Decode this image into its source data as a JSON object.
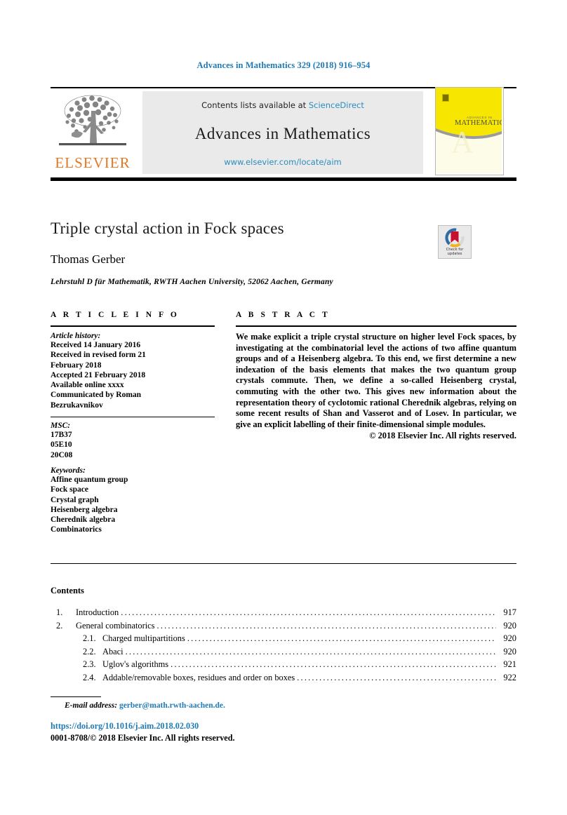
{
  "running_head": "Advances in Mathematics 329 (2018) 916–954",
  "masthead": {
    "contents_prefix": "Contents lists available at ",
    "sciencedirect": "ScienceDirect",
    "journal_name": "Advances in Mathematics",
    "journal_url": "www.elsevier.com/locate/aim",
    "publisher_wordmark": "ELSEVIER",
    "cover_title_small": "ADVANCES IN",
    "cover_title_main": "MATHEMATICS",
    "cover_letter": "A"
  },
  "article": {
    "title": "Triple crystal action in Fock spaces",
    "author": "Thomas Gerber",
    "affiliation": "Lehrstuhl D für Mathematik, RWTH Aachen University, 52062 Aachen, Germany"
  },
  "crossmark": {
    "line1": "Check for",
    "line2": "updates"
  },
  "info": {
    "heading": "A R T I C L E   I N F O",
    "history_label": "Article history:",
    "history": [
      "Received 14 January 2016",
      "Received in revised form 21",
      "February 2018",
      "Accepted 21 February 2018",
      "Available online xxxx",
      "Communicated by Roman",
      "Bezrukavnikov"
    ],
    "msc_label": "MSC:",
    "msc": [
      "17B37",
      "05E10",
      "20C08"
    ],
    "keywords_label": "Keywords:",
    "keywords": [
      "Affine quantum group",
      "Fock space",
      "Crystal graph",
      "Heisenberg algebra",
      "Cherednik algebra",
      "Combinatorics"
    ]
  },
  "abstract": {
    "heading": "A B S T R A C T",
    "text": "We make explicit a triple crystal structure on higher level Fock spaces, by investigating at the combinatorial level the actions of two affine quantum groups and of a Heisenberg algebra. To this end, we first determine a new indexation of the basis elements that makes the two quantum group crystals commute. Then, we define a so-called Heisenberg crystal, commuting with the other two. This gives new information about the representation theory of cyclotomic rational Cherednik algebras, relying on some recent results of Shan and Vasserot and of Losev. In particular, we give an explicit labelling of their finite-dimensional simple modules.",
    "copyright": "© 2018 Elsevier Inc. All rights reserved."
  },
  "contents": {
    "title": "Contents",
    "dots": "...........................................................................................................",
    "entries": [
      {
        "num": "1.",
        "label": "Introduction",
        "page": "917",
        "sub": false
      },
      {
        "num": "2.",
        "label": "General combinatorics",
        "page": "920",
        "sub": false
      },
      {
        "num": "2.1.",
        "label": "Charged multipartitions",
        "page": "920",
        "sub": true
      },
      {
        "num": "2.2.",
        "label": "Abaci",
        "page": "920",
        "sub": true
      },
      {
        "num": "2.3.",
        "label": "Uglov's algorithms",
        "page": "921",
        "sub": true
      },
      {
        "num": "2.4.",
        "label": "Addable/removable boxes, residues and order on boxes",
        "page": "922",
        "sub": true
      }
    ]
  },
  "footer": {
    "email_label": "E-mail address:",
    "email": "gerber@math.rwth-aachen.de.",
    "doi": "https://doi.org/10.1016/j.aim.2018.02.030",
    "issn": "0001-8708/© 2018 Elsevier Inc. All rights reserved."
  },
  "colors": {
    "link_blue": "#1f7bb6",
    "sciencedirect_blue": "#2b8cbe",
    "elsevier_orange": "#E87722",
    "cover_yellow": "#f7e700",
    "masthead_gray": "#eaeaea"
  }
}
